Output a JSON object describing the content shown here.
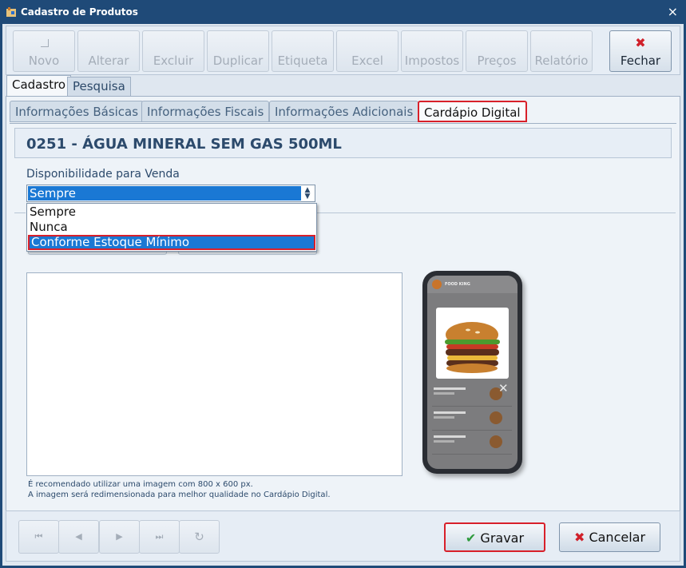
{
  "window": {
    "title": "Cadastro de Produtos",
    "close_glyph": "×"
  },
  "toolbar": {
    "novo": "Novo",
    "alterar": "Alterar",
    "excluir": "Excluir",
    "duplicar": "Duplicar",
    "etiqueta": "Etiqueta",
    "excel": "Excel",
    "impostos": "Impostos",
    "precos": "Preços",
    "relatorio": "Relatório",
    "fechar": "Fechar"
  },
  "main_tabs": {
    "cadastro": "Cadastro",
    "pesquisa": "Pesquisa"
  },
  "sub_tabs": {
    "basicas": "Informações Básicas",
    "fiscais": "Informações Fiscais",
    "adicionais": "Informações Adicionais",
    "cardapio": "Cardápio Digital"
  },
  "product": {
    "title": "0251 - ÁGUA MINERAL SEM GAS 500ML"
  },
  "availability": {
    "label": "Disponibilidade para Venda",
    "selected": "Sempre",
    "options": [
      "Sempre",
      "Nunca",
      "Conforme Estoque Mínimo"
    ]
  },
  "image_hint": {
    "line1": "É recomendado utilizar uma imagem com 800 x  600 px.",
    "line2": "A imagem será redimensionada para melhor qualidade no Cardápio Digital."
  },
  "preview": {
    "brand": "FOOD KING",
    "close_glyph": "✕"
  },
  "nav": {
    "first": "⏮",
    "prev": "◀",
    "next": "▶",
    "last": "⏭",
    "refresh": "↻"
  },
  "actions": {
    "gravar": "Gravar",
    "cancelar": "Cancelar",
    "check_glyph": "✔",
    "cross_glyph": "✖"
  },
  "colors": {
    "accent_blue": "#1a78d4",
    "highlight_red": "#d8202a",
    "title_bar": "#1f4a78"
  }
}
